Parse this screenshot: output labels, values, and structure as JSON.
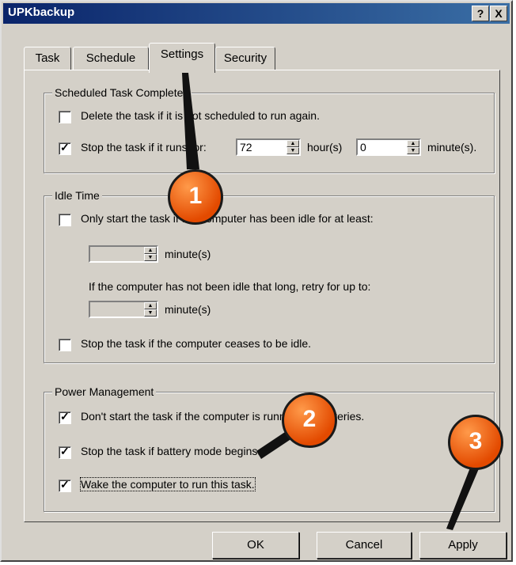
{
  "window": {
    "title": "UPKbackup",
    "help_btn": "?",
    "close_btn": "X"
  },
  "tabs": [
    "Task",
    "Schedule",
    "Settings",
    "Security"
  ],
  "scheduled": {
    "legend": "Scheduled Task Completed",
    "delete_label": "Delete the task if it is not scheduled to run again.",
    "stop_label": "Stop the task if it runs for:",
    "hours_value": "72",
    "hours_label": "hour(s)",
    "minutes_value": "0",
    "minutes_label": "minute(s)."
  },
  "idle": {
    "legend": "Idle Time",
    "only_start_label": "Only start the task if the computer has been idle for at least:",
    "minutes_label": "minute(s)",
    "retry_text": "If the computer has not been idle that long, retry for up to:",
    "retry_minutes_label": "minute(s)",
    "stop_idle_label": "Stop the task if the computer ceases to be idle."
  },
  "power": {
    "legend": "Power Management",
    "no_batteries_label": "Don't start the task if the computer is running on batteries.",
    "battery_mode_label": "Stop the task if battery mode begins.",
    "wake_label": "Wake the computer to run this task."
  },
  "buttons": {
    "ok": "OK",
    "cancel": "Cancel",
    "apply": "Apply"
  },
  "callouts": [
    "1",
    "2",
    "3"
  ],
  "colors": {
    "titlebar_start": "#0a246a",
    "titlebar_end": "#3a6ea5",
    "callout": "#e34a00",
    "face": "#d4d0c8"
  }
}
